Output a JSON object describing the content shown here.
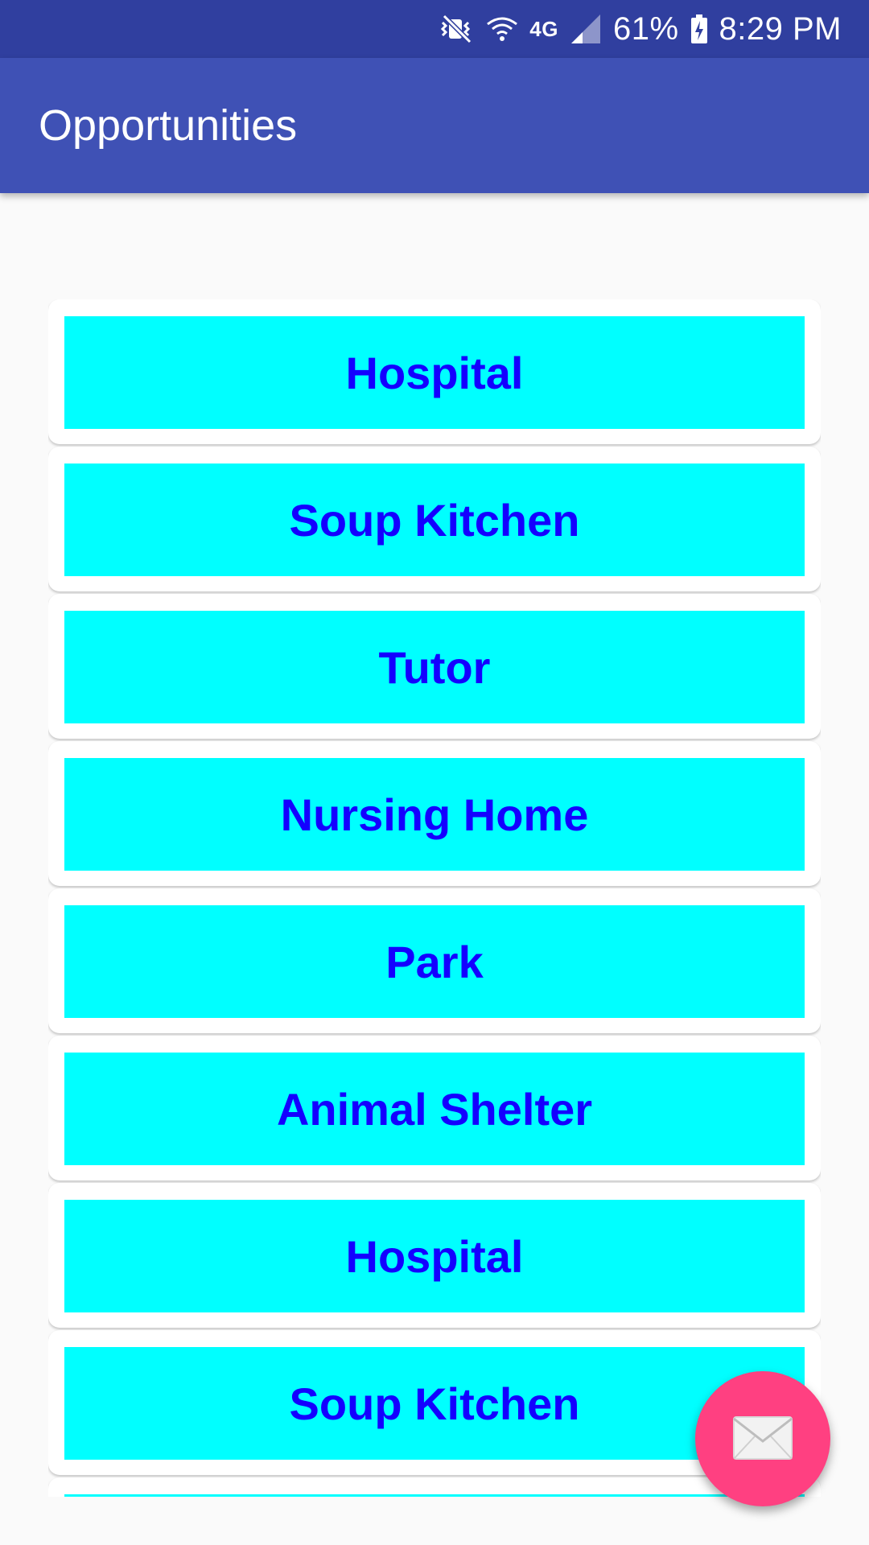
{
  "status_bar": {
    "icons": [
      "vibrate-mute-icon",
      "wifi-icon",
      "lte-4g-icon",
      "cellular-signal-icon",
      "battery-charging-icon"
    ],
    "network_label": "4G",
    "battery_percent": "61%",
    "time": "8:29 PM"
  },
  "app_bar": {
    "title": "Opportunities"
  },
  "opportunities": [
    {
      "label": "Hospital"
    },
    {
      "label": "Soup Kitchen"
    },
    {
      "label": "Tutor"
    },
    {
      "label": "Nursing Home"
    },
    {
      "label": "Park"
    },
    {
      "label": "Animal Shelter"
    },
    {
      "label": "Hospital"
    },
    {
      "label": "Soup Kitchen"
    },
    {
      "label": ""
    }
  ],
  "fab": {
    "icon": "mail-icon"
  },
  "colors": {
    "status_bar": "#303f9f",
    "app_bar": "#3f51b5",
    "item_background": "#00ffff",
    "item_text": "#1400ff",
    "fab": "#ff4081",
    "page_background": "#fafafa"
  }
}
